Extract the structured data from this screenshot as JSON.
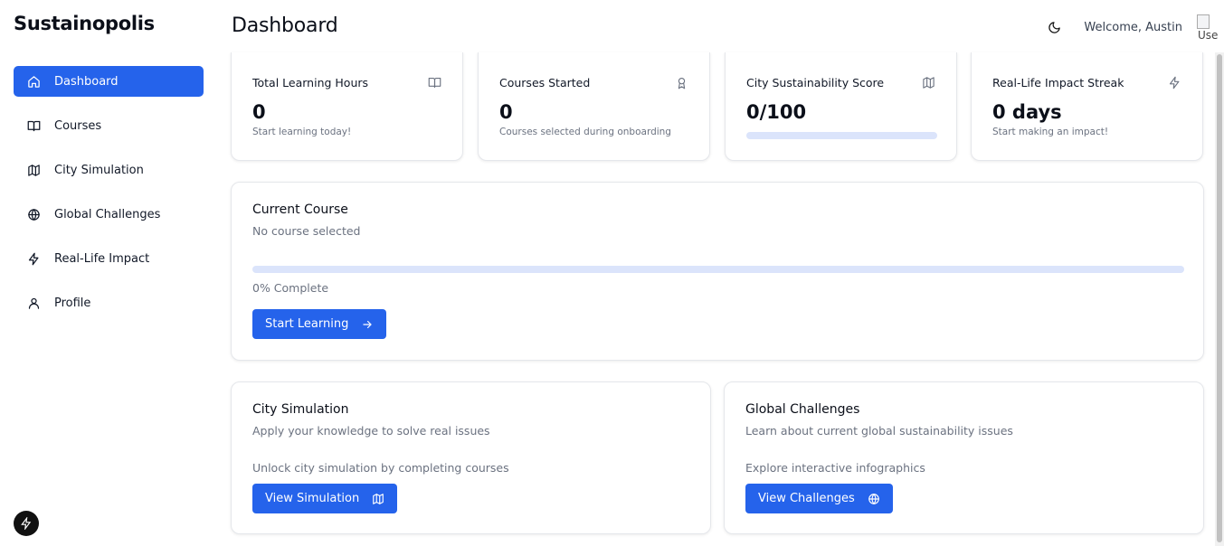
{
  "app": {
    "brand": "Sustainopolis"
  },
  "header": {
    "title": "Dashboard",
    "welcome": "Welcome, Austin",
    "avatar_alt": "Use"
  },
  "sidebar": {
    "items": [
      {
        "label": "Dashboard",
        "icon": "home-icon",
        "active": true
      },
      {
        "label": "Courses",
        "icon": "book-icon"
      },
      {
        "label": "City Simulation",
        "icon": "map-icon"
      },
      {
        "label": "Global Challenges",
        "icon": "globe-icon"
      },
      {
        "label": "Real-Life Impact",
        "icon": "zap-icon"
      },
      {
        "label": "Profile",
        "icon": "user-icon"
      }
    ]
  },
  "stats": [
    {
      "label": "Total Learning Hours",
      "value": "0",
      "sub": "Start learning today!",
      "icon": "book-icon"
    },
    {
      "label": "Courses Started",
      "value": "0",
      "sub": "Courses selected during onboarding",
      "icon": "award-icon"
    },
    {
      "label": "City Sustainability Score",
      "value": "0/100",
      "progress": 0,
      "icon": "map-icon"
    },
    {
      "label": "Real-Life Impact Streak",
      "value": "0 days",
      "sub": "Start making an impact!",
      "icon": "zap-icon"
    }
  ],
  "current_course": {
    "title": "Current Course",
    "subtitle": "No course selected",
    "progress": 0,
    "percent_label": "0% Complete",
    "button": "Start Learning"
  },
  "city_simulation": {
    "title": "City Simulation",
    "subtitle": "Apply your knowledge to solve real issues",
    "desc": "Unlock city simulation by completing courses",
    "button": "View Simulation"
  },
  "global_challenges": {
    "title": "Global Challenges",
    "subtitle": "Learn about current global sustainability issues",
    "desc": "Explore interactive infographics",
    "button": "View Challenges"
  },
  "colors": {
    "accent": "#2563eb",
    "track": "#dbe4fb"
  }
}
